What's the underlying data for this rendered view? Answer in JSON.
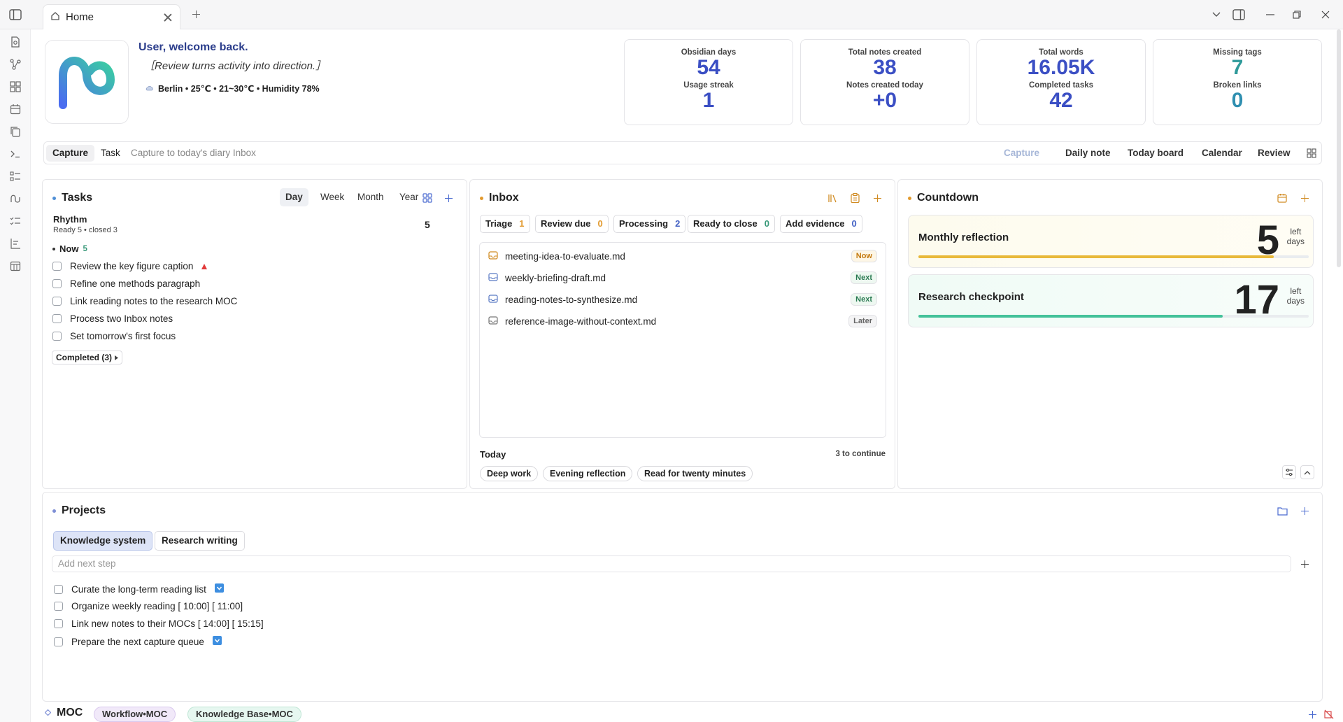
{
  "titlebar": {
    "tab_label": "Home"
  },
  "header": {
    "welcome": "User, welcome back.",
    "quote": "［Review turns activity into direction.］",
    "weather": "Berlin • 25℃ • 21~30℃ • Humidity 78%"
  },
  "stats": [
    {
      "label_top": "Obsidian days",
      "value_top": "54",
      "label_bottom": "Usage streak",
      "value_bottom": "1"
    },
    {
      "label_top": "Total notes created",
      "value_top": "38",
      "label_bottom": "Notes created today",
      "value_bottom": "+0"
    },
    {
      "label_top": "Total words",
      "value_top": "16.05K",
      "label_bottom": "Completed tasks",
      "value_bottom": "42"
    },
    {
      "label_top": "Missing tags",
      "value_top": "7",
      "label_bottom": "Broken links",
      "value_bottom": "0"
    }
  ],
  "capture": {
    "tab_capture": "Capture",
    "tab_task": "Task",
    "placeholder": "Capture to today's diary Inbox",
    "capture_button": "Capture",
    "links": [
      "Daily note",
      "Today board",
      "Calendar",
      "Review"
    ]
  },
  "tasks": {
    "title": "Tasks",
    "periods": [
      "Day",
      "Week",
      "Month",
      "Year"
    ],
    "rhythm_title": "Rhythm",
    "rhythm_sub": "Ready 5 • closed 3",
    "rhythm_count": "5",
    "now_label": "Now",
    "now_count": "5",
    "items": [
      "Review the key figure caption",
      "Refine one methods paragraph",
      "Link reading notes to the research MOC",
      "Process two Inbox notes",
      "Set tomorrow's first focus"
    ],
    "completed_label": "Completed (3)"
  },
  "inbox": {
    "title": "Inbox",
    "chips": [
      {
        "label": "Triage",
        "count": "1"
      },
      {
        "label": "Review due",
        "count": "0"
      },
      {
        "label": "Processing",
        "count": "2"
      },
      {
        "label": "Ready to close",
        "count": "0"
      },
      {
        "label": "Add evidence",
        "count": "0"
      }
    ],
    "files": [
      {
        "name": "meeting-idea-to-evaluate.md",
        "badge": "Now"
      },
      {
        "name": "weekly-briefing-draft.md",
        "badge": "Next"
      },
      {
        "name": "reading-notes-to-synthesize.md",
        "badge": "Next"
      },
      {
        "name": "reference-image-without-context.md",
        "badge": "Later"
      }
    ],
    "today_label": "Today",
    "continue_label": "3 to continue",
    "today_pills": [
      "Deep work",
      "Evening reflection",
      "Read for twenty minutes"
    ]
  },
  "countdown": {
    "title": "Countdown",
    "items": [
      {
        "title": "Monthly reflection",
        "days": "5",
        "unit_top": "left",
        "unit_bottom": "days",
        "progress": 0.91,
        "color": "#e8b93a"
      },
      {
        "title": "Research checkpoint",
        "days": "17",
        "unit_top": "left",
        "unit_bottom": "days",
        "progress": 0.78,
        "color": "#44c29a"
      }
    ]
  },
  "projects": {
    "title": "Projects",
    "tabs": [
      "Knowledge system",
      "Research writing"
    ],
    "add_placeholder": "Add next step",
    "items": [
      "Curate the long-term reading list",
      "Organize weekly reading [ 10:00] [ 11:00]",
      "Link new notes to their MOCs [ 14:00] [ 15:15]",
      "Prepare the next capture queue"
    ]
  },
  "moc": {
    "title": "MOC",
    "pills": [
      "Workflow•MOC",
      "Knowledge Base•MOC"
    ]
  },
  "colors": {
    "accent": "#3b4fc4",
    "welcome": "#2c3e8c",
    "orange": "#e29a2e"
  }
}
